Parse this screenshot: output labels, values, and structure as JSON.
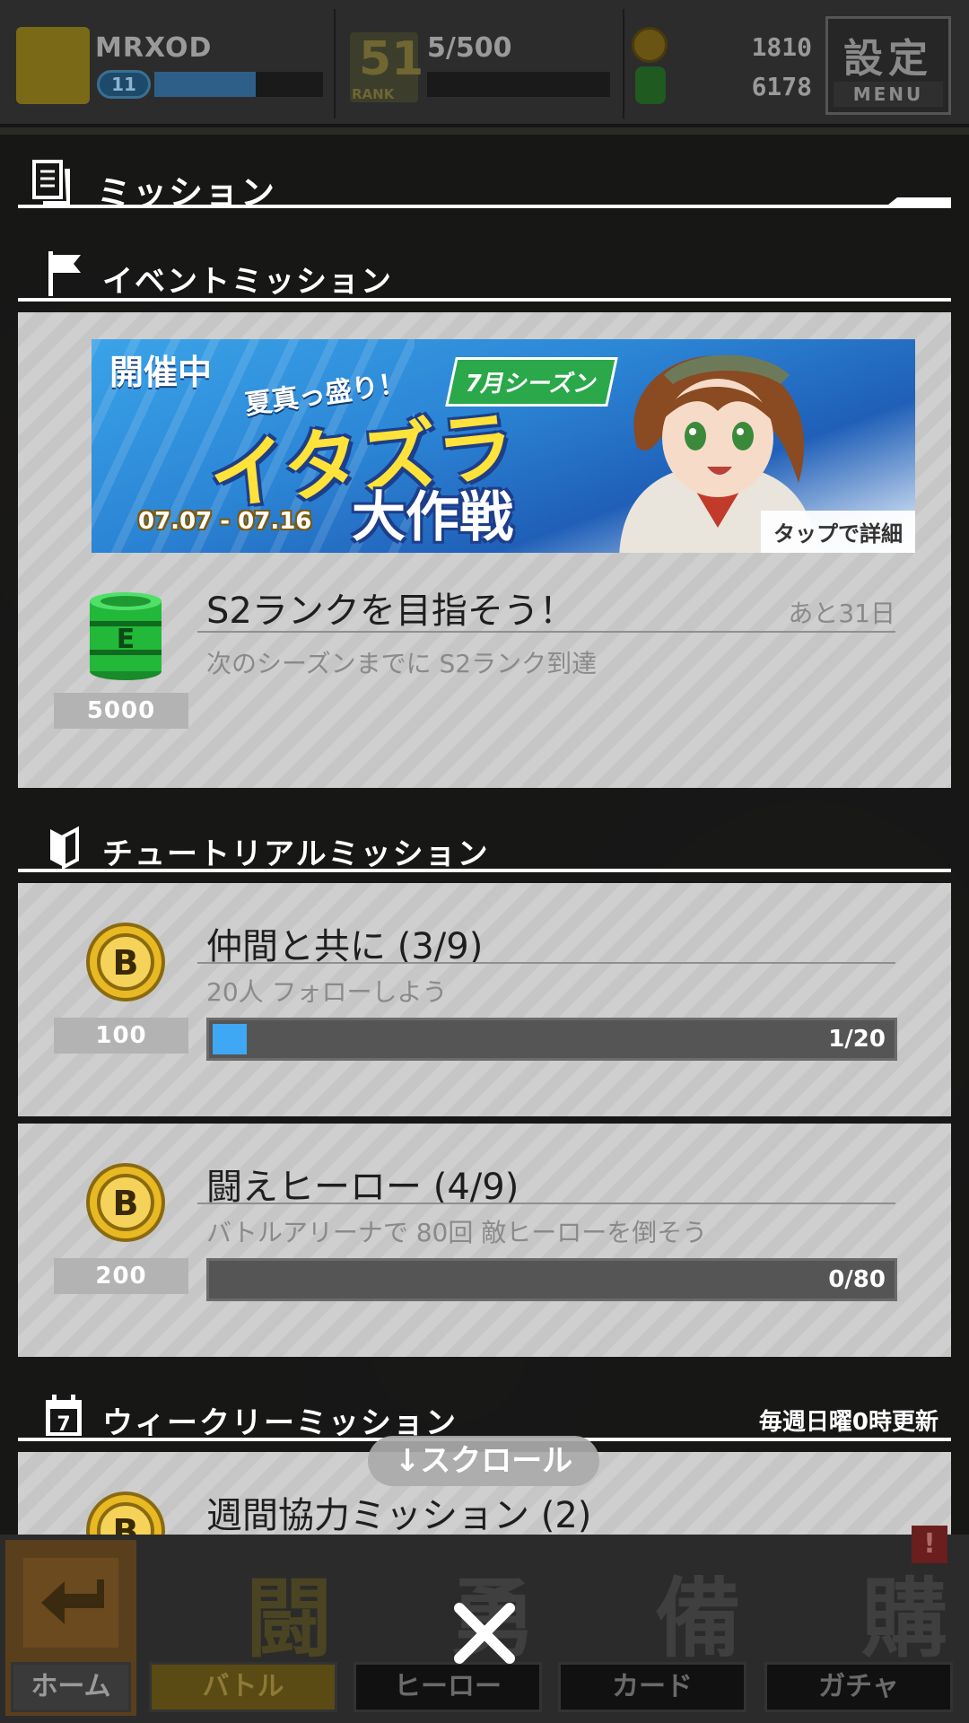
{
  "statusbar": {
    "player_name": "MRXOD",
    "level": "11",
    "level_progress": 0.6,
    "rank": "51",
    "rank_label": "RANK",
    "exp": "5/500",
    "gold": "1810",
    "gems": "6178",
    "menu_kanji": "設定",
    "menu_label": "MENU"
  },
  "panel": {
    "title": "ミッション"
  },
  "sections": {
    "event": {
      "title": "イベントミッション"
    },
    "tutorial": {
      "title": "チュートリアルミッション"
    },
    "weekly": {
      "title": "ウィークリーミッション",
      "note": "毎週日曜0時更新"
    }
  },
  "banner": {
    "status": "開催中",
    "catch": "夏真っ盛り！",
    "season": "7月シーズン",
    "logo_line1": "イタズラ",
    "logo_line2": "大作戦",
    "dates": "07.07 - 07.16",
    "tap_hint": "タップで詳細"
  },
  "missions": {
    "event": {
      "title": "S2ランクを目指そう！",
      "remaining": "あと31日",
      "desc": "次のシーズンまでに S2ランク到達",
      "reward": "5000",
      "reward_icon": "green-can-icon"
    },
    "tutorial1": {
      "title": "仲間と共に (3/9)",
      "desc": "20人 フォローしよう",
      "reward": "100",
      "reward_icon": "gold-coin-icon",
      "progress_text": "1/20",
      "progress": 0.05
    },
    "tutorial2": {
      "title": "闘えヒーロー (4/9)",
      "desc": "バトルアリーナで 80回 敵ヒーローを倒そう",
      "reward": "200",
      "reward_icon": "gold-coin-icon",
      "progress_text": "0/80",
      "progress": 0
    },
    "weekly1": {
      "title": "週間協力ミッション (2)",
      "reward_icon": "gold-coin-icon"
    }
  },
  "scroll_hint": "↓スクロール",
  "nav": {
    "home": "ホーム",
    "battle": "バトル",
    "hero": "ヒーロー",
    "card": "カード",
    "gacha": "ガチャ",
    "battle_kanji": "闘",
    "hero_kanji": "勇",
    "card_kanji": "備",
    "gacha_kanji": "購",
    "alert": "!"
  },
  "colors": {
    "progress_fill": "#3fa8f5",
    "panel_bg": "#161616",
    "card_stripe": "#cfcfcf",
    "gold": "#e8b923",
    "green_can": "#2ecc40"
  }
}
